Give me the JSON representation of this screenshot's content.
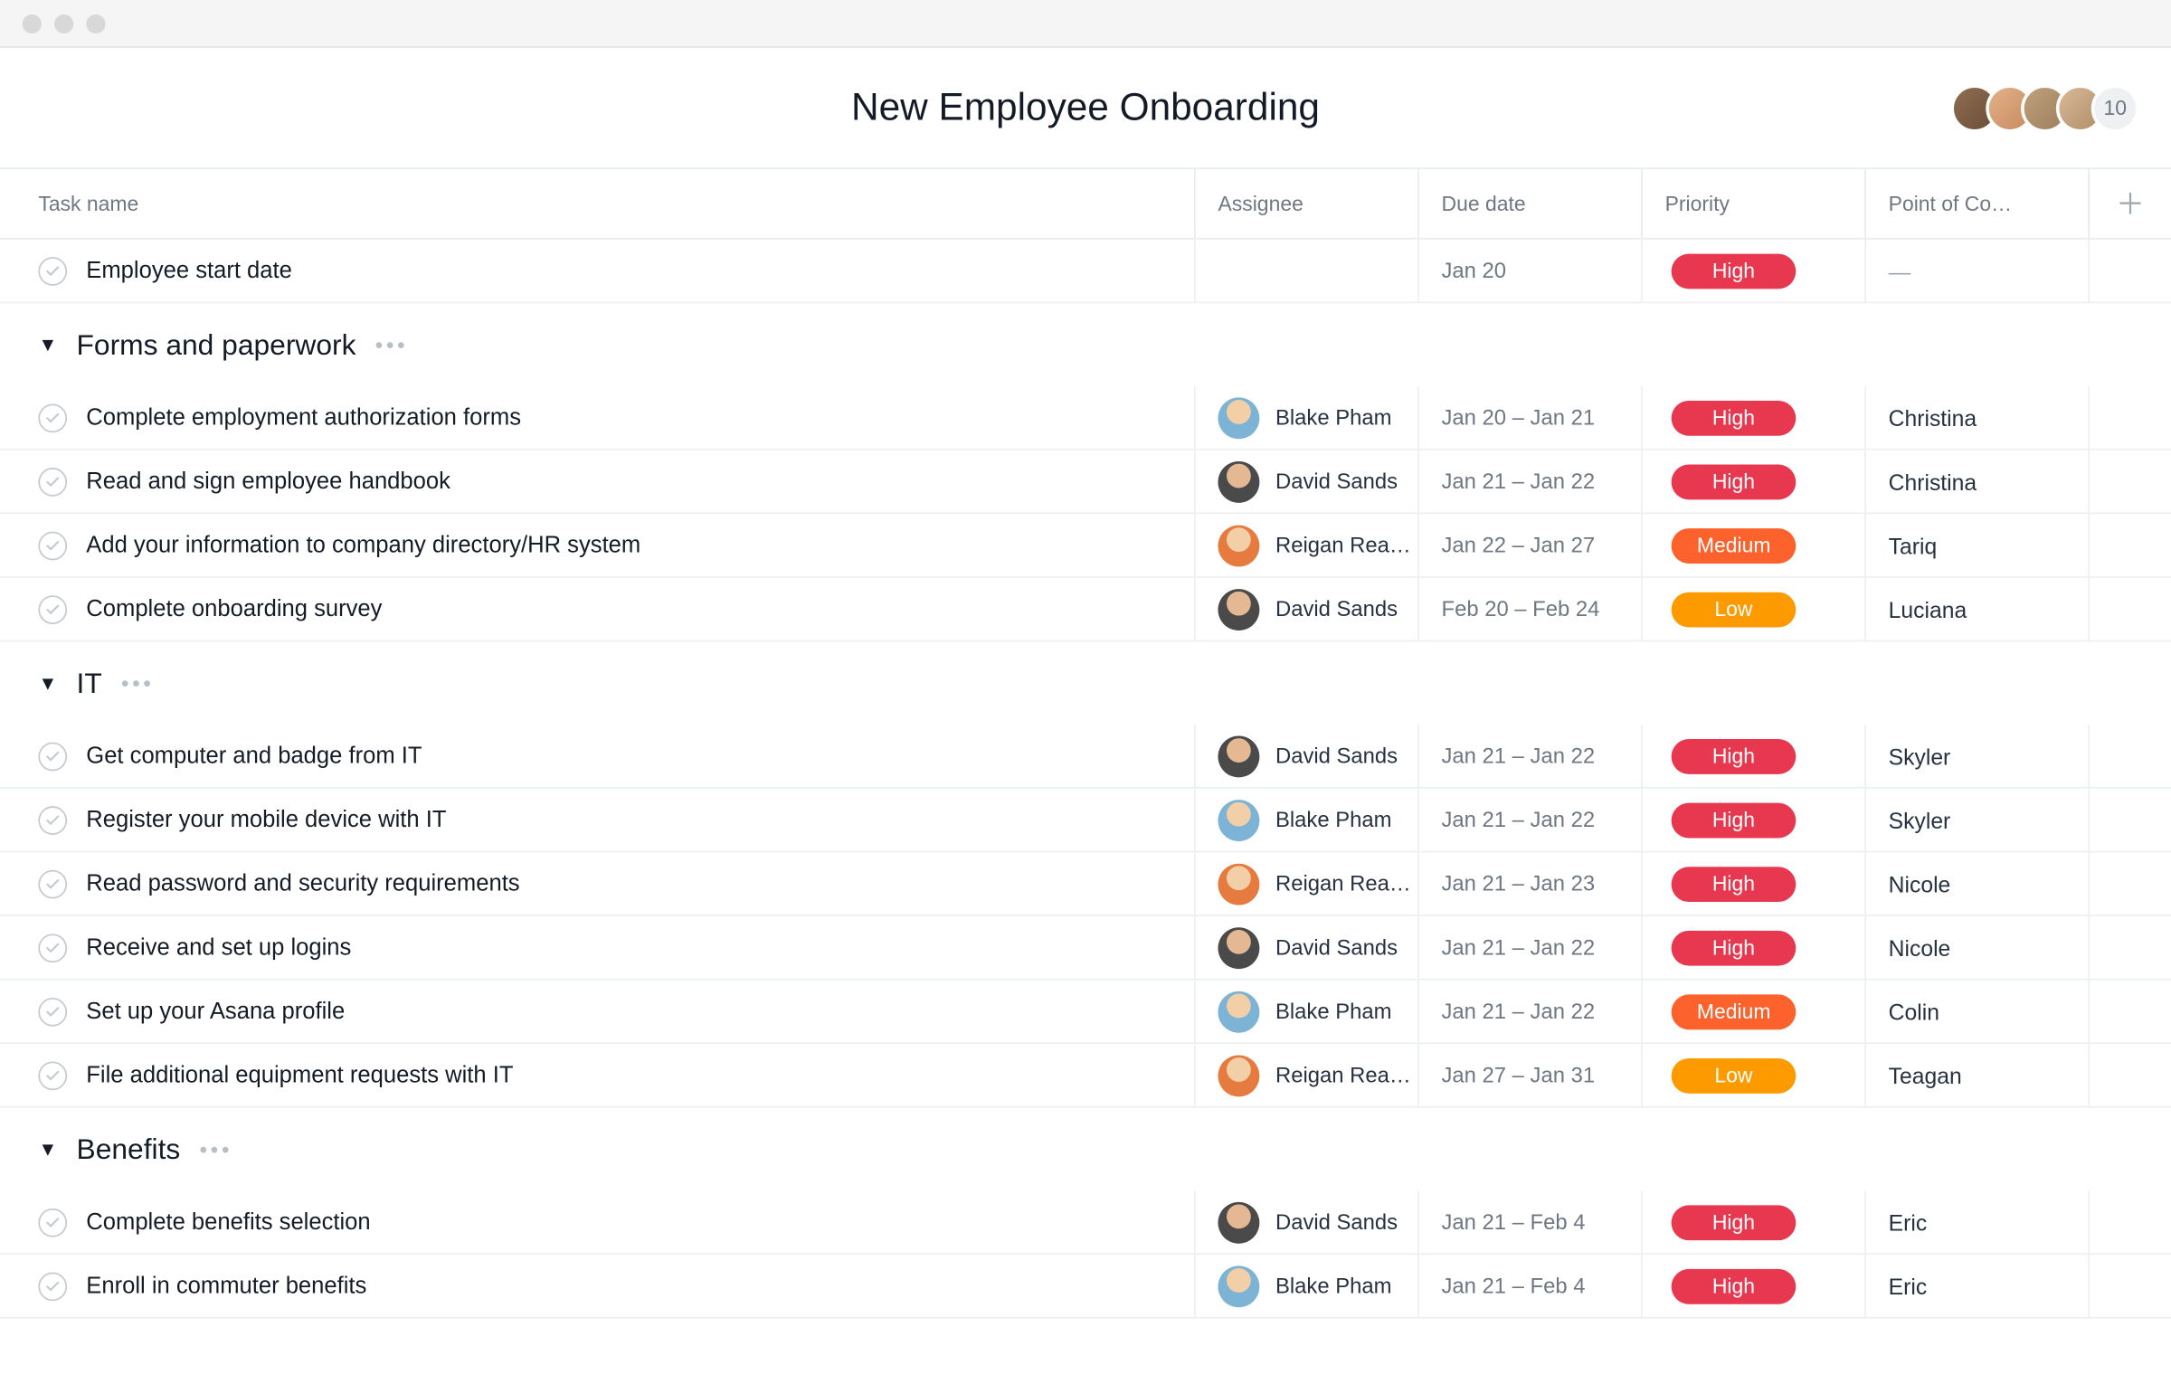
{
  "project": {
    "title": "New Employee Onboarding"
  },
  "members": {
    "overflow_count": "10"
  },
  "columns": {
    "task": "Task name",
    "assignee": "Assignee",
    "due_date": "Due date",
    "priority": "Priority",
    "contact": "Point of Co…"
  },
  "priority_labels": {
    "high": "High",
    "medium": "Medium",
    "low": "Low"
  },
  "assignees": {
    "blake": {
      "name": "Blake Pham",
      "avatar_class": "av-blake"
    },
    "david": {
      "name": "David Sands",
      "avatar_class": "av-david"
    },
    "reigan": {
      "name": "Reigan Rea…",
      "avatar_class": "av-reigan"
    }
  },
  "ungrouped": [
    {
      "name": "Employee start date",
      "assignee": null,
      "due": "Jan 20",
      "priority": "high",
      "contact": "—"
    }
  ],
  "sections": [
    {
      "title": "Forms and paperwork",
      "tasks": [
        {
          "name": "Complete employment authorization forms",
          "assignee": "blake",
          "due": "Jan 20 – Jan 21",
          "priority": "high",
          "contact": "Christina"
        },
        {
          "name": "Read and sign employee handbook",
          "assignee": "david",
          "due": "Jan 21 – Jan 22",
          "priority": "high",
          "contact": "Christina"
        },
        {
          "name": "Add your information to company directory/HR system",
          "assignee": "reigan",
          "due": "Jan 22 – Jan 27",
          "priority": "medium",
          "contact": "Tariq"
        },
        {
          "name": "Complete onboarding survey",
          "assignee": "david",
          "due": "Feb 20 – Feb 24",
          "priority": "low",
          "contact": "Luciana"
        }
      ]
    },
    {
      "title": "IT",
      "tasks": [
        {
          "name": "Get computer and badge from IT",
          "assignee": "david",
          "due": "Jan 21 – Jan 22",
          "priority": "high",
          "contact": "Skyler"
        },
        {
          "name": "Register your mobile device with IT",
          "assignee": "blake",
          "due": "Jan 21 – Jan 22",
          "priority": "high",
          "contact": "Skyler"
        },
        {
          "name": "Read password and security requirements",
          "assignee": "reigan",
          "due": "Jan 21 – Jan 23",
          "priority": "high",
          "contact": "Nicole"
        },
        {
          "name": "Receive and set up logins",
          "assignee": "david",
          "due": "Jan 21 – Jan 22",
          "priority": "high",
          "contact": "Nicole"
        },
        {
          "name": "Set up your Asana profile",
          "assignee": "blake",
          "due": "Jan 21 – Jan 22",
          "priority": "medium",
          "contact": "Colin"
        },
        {
          "name": "File additional equipment requests with IT",
          "assignee": "reigan",
          "due": "Jan 27 – Jan 31",
          "priority": "low",
          "contact": "Teagan"
        }
      ]
    },
    {
      "title": "Benefits",
      "tasks": [
        {
          "name": "Complete benefits selection",
          "assignee": "david",
          "due": "Jan 21 – Feb 4",
          "priority": "high",
          "contact": "Eric"
        },
        {
          "name": "Enroll in commuter benefits",
          "assignee": "blake",
          "due": "Jan 21 – Feb 4",
          "priority": "high",
          "contact": "Eric"
        }
      ]
    }
  ]
}
